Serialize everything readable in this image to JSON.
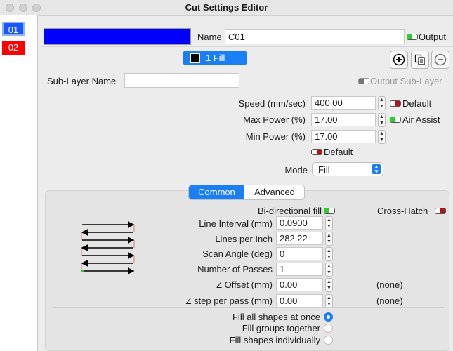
{
  "window": {
    "title": "Cut Settings Editor"
  },
  "layers": [
    {
      "label": "01",
      "color": "#1a56ff",
      "selected": true
    },
    {
      "label": "02",
      "color": "#ff0000",
      "selected": false
    }
  ],
  "header": {
    "layer_color": "#0000ff",
    "name_label": "Name",
    "name_value": "C01",
    "output_label": "Output"
  },
  "sublayer_bar": {
    "tab_label": "1 Fill",
    "add_icon": "plus-circle-icon",
    "copy_icon": "copy-icon",
    "remove_icon": "minus-circle-icon"
  },
  "sublayer": {
    "name_label": "Sub-Layer Name",
    "name_value": "",
    "output_sublayer_label": "Output Sub-Layer"
  },
  "settings": {
    "speed_label": "Speed (mm/sec)",
    "speed_value": "400.00",
    "default_label": "Default",
    "max_power_label": "Max Power (%)",
    "max_power_value": "17.00",
    "air_assist_label": "Air Assist",
    "min_power_label": "Min Power (%)",
    "min_power_value": "17.00",
    "default2_label": "Default",
    "mode_label": "Mode",
    "mode_value": "Fill"
  },
  "tabs": {
    "common": "Common",
    "advanced": "Advanced"
  },
  "fill": {
    "bidirectional_label": "Bi-directional fill",
    "crosshatch_label": "Cross-Hatch",
    "line_interval_label": "Line Interval (mm)",
    "line_interval_value": "0.0900",
    "lines_per_inch_label": "Lines per Inch",
    "lines_per_inch_value": "282.22",
    "scan_angle_label": "Scan Angle (deg)",
    "scan_angle_value": "0",
    "passes_label": "Number of Passes",
    "passes_value": "1",
    "z_offset_label": "Z Offset (mm)",
    "z_offset_value": "0.00",
    "z_offset_note": "(none)",
    "z_step_label": "Z step per pass (mm)",
    "z_step_value": "0.00",
    "z_step_note": "(none)"
  },
  "fill_options": [
    {
      "label": "Fill all shapes at once",
      "selected": true
    },
    {
      "label": "Fill groups together",
      "selected": false
    },
    {
      "label": "Fill shapes individually",
      "selected": false
    }
  ],
  "colors": {
    "accent": "#1a7ef5",
    "toggle_on": "#2ecc2e",
    "toggle_off": "#b3121b"
  }
}
